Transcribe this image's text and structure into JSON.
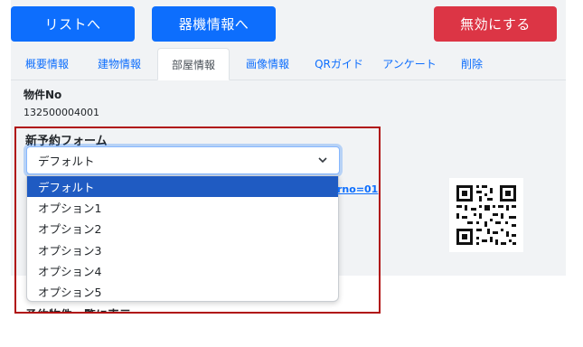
{
  "header": {
    "list_button": "リストへ",
    "device_button": "器機情報へ",
    "disable_button": "無効にする",
    "colors": {
      "primary": "#0d6efd",
      "danger": "#dc3545"
    }
  },
  "tabs": [
    {
      "label": "概要情報"
    },
    {
      "label": "建物情報"
    },
    {
      "label": "部屋情報"
    },
    {
      "label": "画像情報"
    },
    {
      "label": "QRガイド"
    },
    {
      "label": "アンケート"
    },
    {
      "label": "削除"
    }
  ],
  "active_tab": "部屋情報",
  "property": {
    "label": "物件No",
    "value": "132500004001"
  },
  "form": {
    "label": "新予約フォーム",
    "selected": "デフォルト",
    "options": [
      "デフォルト",
      "オプション1",
      "オプション2",
      "オプション3",
      "オプション4",
      "オプション5"
    ]
  },
  "link_fragment": "rno=01",
  "below_label": "予約物件一覧に表示"
}
